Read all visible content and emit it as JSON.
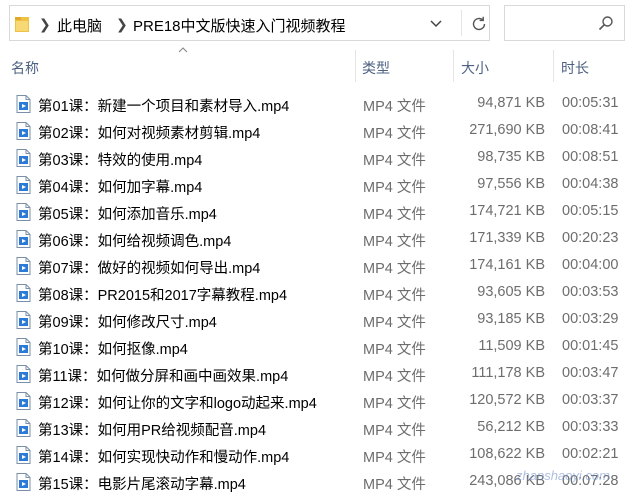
{
  "address_bar": {
    "crumbs": [
      "此电脑",
      "PRE18中文版快速入门视频教程"
    ]
  },
  "search": {
    "placeholder": ""
  },
  "columns": {
    "name": "名称",
    "type": "类型",
    "size": "大小",
    "duration": "时长"
  },
  "files": [
    {
      "name": "第01课：新建一个项目和素材导入.mp4",
      "type": "MP4 文件",
      "size": "94,871 KB",
      "duration": "00:05:31"
    },
    {
      "name": "第02课：如何对视频素材剪辑.mp4",
      "type": "MP4 文件",
      "size": "271,690 KB",
      "duration": "00:08:41"
    },
    {
      "name": "第03课：特效的使用.mp4",
      "type": "MP4 文件",
      "size": "98,735 KB",
      "duration": "00:08:51"
    },
    {
      "name": "第04课：如何加字幕.mp4",
      "type": "MP4 文件",
      "size": "97,556 KB",
      "duration": "00:04:38"
    },
    {
      "name": "第05课：如何添加音乐.mp4",
      "type": "MP4 文件",
      "size": "174,721 KB",
      "duration": "00:05:15"
    },
    {
      "name": "第06课：如何给视频调色.mp4",
      "type": "MP4 文件",
      "size": "171,339 KB",
      "duration": "00:20:23"
    },
    {
      "name": "第07课：做好的视频如何导出.mp4",
      "type": "MP4 文件",
      "size": "174,161 KB",
      "duration": "00:04:00"
    },
    {
      "name": "第08课：PR2015和2017字幕教程.mp4",
      "type": "MP4 文件",
      "size": "93,605 KB",
      "duration": "00:03:53"
    },
    {
      "name": "第09课：如何修改尺寸.mp4",
      "type": "MP4 文件",
      "size": "93,185 KB",
      "duration": "00:03:29"
    },
    {
      "name": "第10课：如何抠像.mp4",
      "type": "MP4 文件",
      "size": "11,509 KB",
      "duration": "00:01:45"
    },
    {
      "name": "第11课：如何做分屏和画中画效果.mp4",
      "type": "MP4 文件",
      "size": "111,178 KB",
      "duration": "00:03:47"
    },
    {
      "name": "第12课：如何让你的文字和logo动起来.mp4",
      "type": "MP4 文件",
      "size": "120,572 KB",
      "duration": "00:03:37"
    },
    {
      "name": "第13课：如何用PR给视频配音.mp4",
      "type": "MP4 文件",
      "size": "56,212 KB",
      "duration": "00:03:33"
    },
    {
      "name": "第14课：如何实现快动作和慢动作.mp4",
      "type": "MP4 文件",
      "size": "108,622 KB",
      "duration": "00:02:21"
    },
    {
      "name": "第15课：电影片尾滚动字幕.mp4",
      "type": "MP4 文件",
      "size": "243,086 KB",
      "duration": "00:07:28"
    }
  ],
  "watermark": "zhanshaoyi.com",
  "icons": {
    "folder": "folder-icon",
    "refresh": "refresh-icon",
    "search": "search-icon",
    "dropdown": "chevron-down-icon",
    "file": "mp4-file-icon"
  },
  "colors": {
    "header_text": "#4d6182",
    "detail_text": "#6d6d6d",
    "folder": "#f0c243",
    "file_icon_accent": "#2b7bd6"
  }
}
